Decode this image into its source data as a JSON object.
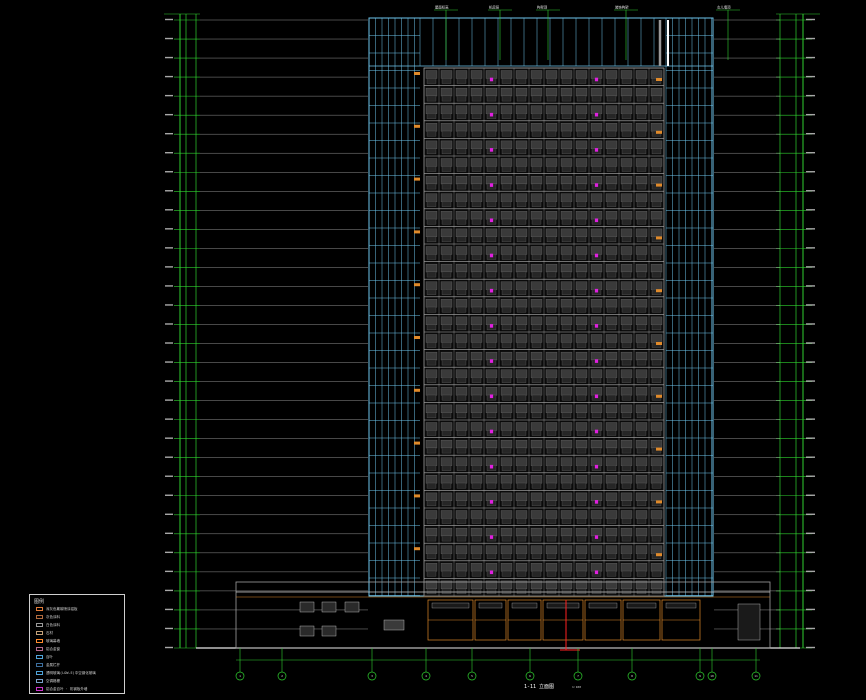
{
  "drawing": {
    "title": "1-11 立面图",
    "scale": "1:100"
  },
  "legend": {
    "header": "图例",
    "items": [
      {
        "label": "深灰色氟碳喷涂铝板",
        "color": "#e07b3a"
      },
      {
        "label": "灰色涂料",
        "color": "#b26b3e"
      },
      {
        "label": "白色涂料",
        "color": "#9a9a9a"
      },
      {
        "label": "石材",
        "color": "#c4a27a"
      },
      {
        "label": "玻璃幕墙",
        "color": "#ff8c2e"
      },
      {
        "label": "铝合金窗",
        "color": "#b36b8f"
      },
      {
        "label": "百叶",
        "color": "#4fa3d9"
      },
      {
        "label": "金属栏杆",
        "color": "#3d6f9e"
      },
      {
        "label": "透明玻璃(LOW-E)中空钢化玻璃",
        "color": "#4fa3d9"
      },
      {
        "label": "空调格栅",
        "color": "#7aa0c8"
      },
      {
        "label": "铝合金百叶 · 彩钢板外墙",
        "color": "#cc33cc"
      }
    ]
  },
  "top_tags": [
    "屋面标高",
    "机房层",
    "构架顶",
    "装饰构架",
    "女儿墙顶"
  ],
  "axes": [
    "1",
    "2",
    "3",
    "4",
    "5",
    "6",
    "7",
    "8",
    "9",
    "10",
    "11"
  ],
  "colors": {
    "background": "#000000",
    "dim_green": "#2fd12f",
    "curtain_blue": "#6fc6ee",
    "facade_gray": "#8c8c8c",
    "accent_magenta": "#e020e0",
    "accent_orange": "#e08a2a",
    "accent_red": "#ff2020"
  }
}
